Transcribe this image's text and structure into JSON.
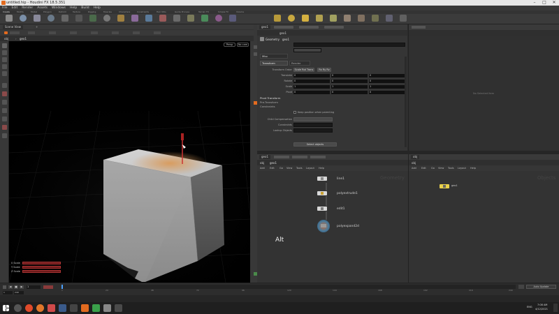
{
  "window": {
    "title": "untitled.hip - Houdini FX 18.5.351"
  },
  "menubar": {
    "items": [
      "File",
      "Edit",
      "Render",
      "Assets",
      "Windows",
      "Help",
      "Build",
      "Help"
    ]
  },
  "shelf": {
    "tabs": [
      "Create",
      "Modify",
      "Model",
      "Polygon",
      "Deform",
      "Texture",
      "Rigging",
      "Muscles",
      "Characters",
      "Constraints",
      "Hair Utils",
      "Guide Process",
      "Terrain FX",
      "Simple FX",
      "Volume"
    ],
    "tools": [
      "Box",
      "Sphere",
      "Tube",
      "Torus",
      "Grid",
      "Null",
      "Line",
      "Circle",
      "Curve",
      "Draw Curve",
      "Path",
      "Spray Paint",
      "Font",
      "Platonic Solids",
      "L-System",
      "Metaball",
      "File"
    ]
  },
  "viewport": {
    "tab_label": "Scene View",
    "camera_menu": "Persp",
    "view_menu": "No cam",
    "path": "obj",
    "path_node": "geo1",
    "hud": [
      "0 Scale",
      "Y Scale",
      "Z Scale"
    ]
  },
  "params": {
    "tab_label": "geo1",
    "node_type": "Geometry",
    "node_name": "geo1",
    "transform_tab": "Transform",
    "render_tab": "Render",
    "misc_tab": "Misc",
    "rows": [
      {
        "label": "Transform Order",
        "v1": "Scale Rot Trans",
        "v2": "Rx Ry Rz"
      },
      {
        "label": "Translate",
        "x": "0",
        "y": "0",
        "z": "0"
      },
      {
        "label": "Rotate",
        "x": "0",
        "y": "0",
        "z": "0"
      },
      {
        "label": "Scale",
        "x": "1",
        "y": "1",
        "z": "1"
      },
      {
        "label": "Pivot",
        "x": "0",
        "y": "0",
        "z": "0"
      }
    ],
    "section_labels": [
      "Pivot Transform",
      "Pre-Transform",
      "Constraints"
    ],
    "checkbox_label": "Keep position when parenting",
    "extra_labels": [
      "Child Compensation",
      "Constraints",
      "Lookup Objects"
    ],
    "button_label": "Select objects",
    "empty_hint": "No Selected Item"
  },
  "network1": {
    "tab_label": "geo1",
    "path": "obj",
    "path_node": "geo1",
    "watermark": "Geometry",
    "menu": [
      "Add",
      "Edit",
      "Go",
      "View",
      "Tools",
      "Layout",
      "Help"
    ],
    "nodes": [
      {
        "name": "line1",
        "color": "#d8d8d8"
      },
      {
        "name": "polyextrude1",
        "color": "#d8d8d8"
      },
      {
        "name": "edit1",
        "color": "#d8d8d8"
      },
      {
        "name": "polyexpand2d",
        "color": "#d8d8d8"
      }
    ],
    "overlay_text": "Alt"
  },
  "network2": {
    "tab_label": "obj",
    "path": "obj",
    "watermark": "Objects",
    "menu": [
      "Add",
      "Edit",
      "Go",
      "View",
      "Tools",
      "Layout",
      "Help"
    ],
    "nodes": [
      {
        "name": "geo1",
        "color": "#e8d04a"
      }
    ]
  },
  "timeline": {
    "frame": "1",
    "start": "1",
    "end": "240",
    "ticks": [
      "1",
      "24",
      "48",
      "72",
      "96",
      "120",
      "144",
      "168",
      "192",
      "216",
      "240"
    ],
    "auto_update": "Auto Update"
  },
  "taskbar": {
    "time": "7:08 AM",
    "date": "4/12/2021",
    "lang": "ENG"
  },
  "colors": {
    "accent_orange": "#e36b1f",
    "highlight_orange": "#d99a5a",
    "node_yellow": "#e8d04a"
  }
}
